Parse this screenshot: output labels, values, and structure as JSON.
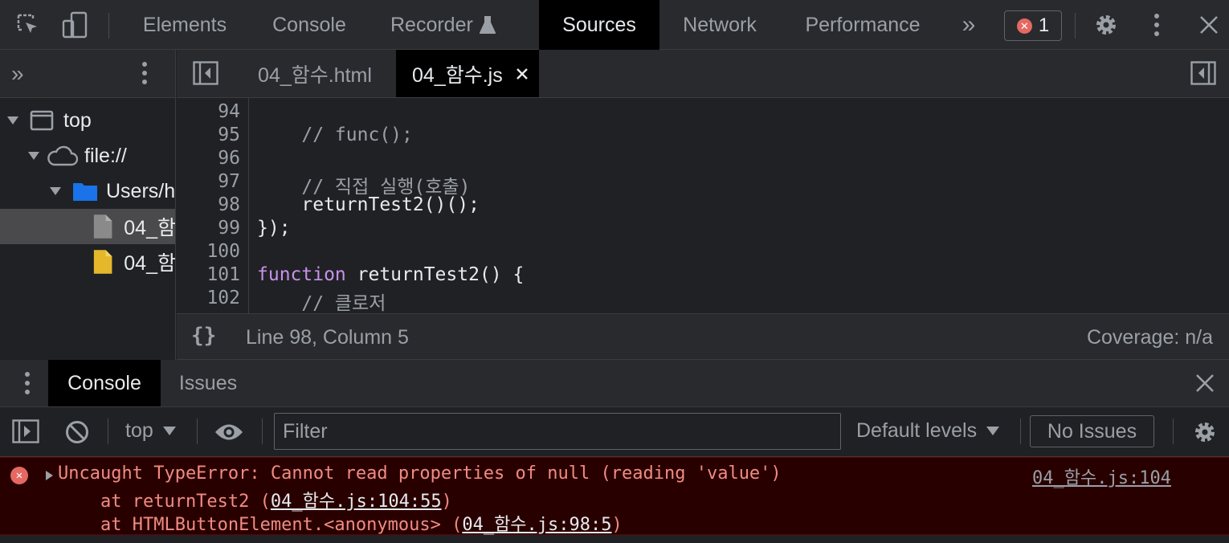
{
  "topbar": {
    "tabs": [
      "Elements",
      "Console",
      "Recorder",
      "Sources",
      "Network",
      "Performance"
    ],
    "active_tab": "Sources",
    "error_count": "1",
    "more_tabs_glyph": "»"
  },
  "navigator": {
    "tree": [
      {
        "label": "top",
        "icon": "frame-icon",
        "expanded": true
      },
      {
        "label": "file://",
        "icon": "cloud-icon",
        "expanded": true
      },
      {
        "label": "Users/h",
        "icon": "folder-icon",
        "expanded": true
      },
      {
        "label": "04_함",
        "icon": "html-file-icon",
        "selected": true
      },
      {
        "label": "04_함",
        "icon": "js-file-icon",
        "selected": false
      }
    ]
  },
  "editor": {
    "tabs": [
      {
        "label": "04_함수.html",
        "active": false
      },
      {
        "label": "04_함수.js",
        "active": true
      }
    ],
    "lines": [
      {
        "num": "94",
        "text": ""
      },
      {
        "num": "95",
        "text": "    // func();"
      },
      {
        "num": "96",
        "text": ""
      },
      {
        "num": "97",
        "text": "    // 직접 실행(호출)"
      },
      {
        "num": "98",
        "text": "    returnTest2()();"
      },
      {
        "num": "99",
        "text": "});"
      },
      {
        "num": "100",
        "text": ""
      },
      {
        "num": "101",
        "text": "function returnTest2() {"
      },
      {
        "num": "102",
        "text": "    // 클로저"
      }
    ],
    "status_position": "Line 98, Column 5",
    "coverage": "Coverage: n/a",
    "format_glyph": "{}"
  },
  "drawer": {
    "tabs": [
      "Console",
      "Issues"
    ],
    "active_tab": "Console"
  },
  "console_toolbar": {
    "context": "top",
    "filter_placeholder": "Filter",
    "levels": "Default levels",
    "issues": "No Issues"
  },
  "error": {
    "message": "Uncaught TypeError: Cannot read properties of null (reading 'value')",
    "source_link": "04_함수.js:104",
    "stack": [
      {
        "prefix": "    at returnTest2 (",
        "link": "04_함수.js:104:55",
        "suffix": ")"
      },
      {
        "prefix": "    at HTMLButtonElement.<anonymous> (",
        "link": "04_함수.js:98:5",
        "suffix": ")"
      }
    ]
  },
  "colors": {
    "background": "#202124",
    "toolbar": "#292a2d",
    "active_tab": "#000000",
    "error_background": "#290000",
    "error_text": "#f28b82",
    "keyword": "#c792ea",
    "folder": "#1a73e8",
    "js_file": "#e5b82c"
  }
}
